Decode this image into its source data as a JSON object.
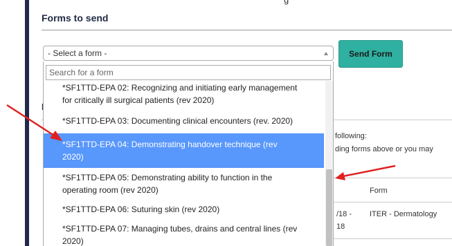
{
  "top_label": "g",
  "page": {
    "title": "Forms to send"
  },
  "form_select": {
    "selected": "- Select a form -",
    "search_placeholder": "Search for a form",
    "send_label": "Send Form",
    "options": [
      {
        "line1": "*SF1TTD-EPA 02: Recognizing and initiating early management",
        "line2": "for critically ill surgical patients (rev 2020)"
      },
      {
        "line1": "*SF1TTD-EPA 03: Documenting clinical encounters (rev. 2020)",
        "line2": ""
      },
      {
        "line1": "*SF1TTD-EPA 04: Demonstrating handover technique (rev",
        "line2": "2020)",
        "highlighted": true
      },
      {
        "line1": "*SF1TTD-EPA 05: Demonstrating ability to function in the",
        "line2": "operating room (rev 2020)"
      },
      {
        "line1": "*SF1TTD-EPA 06: Suturing skin (rev 2020)",
        "line2": ""
      },
      {
        "line1": "*SF1TTD-EPA 07: Managing tubes, drains and central lines (rev",
        "line2": "2020)"
      }
    ]
  },
  "background": {
    "section_letter": "F",
    "following": "following:",
    "forms_hint": "ding forms above or you may",
    "column_form": "Form",
    "row_date_1": "/18 -",
    "row_date_2": "18",
    "row_form": "ITER - Dermatology"
  },
  "annotation_colors": {
    "arrow": "#e02020",
    "highlight": "#5897fb",
    "button": "#2fb0a0"
  }
}
